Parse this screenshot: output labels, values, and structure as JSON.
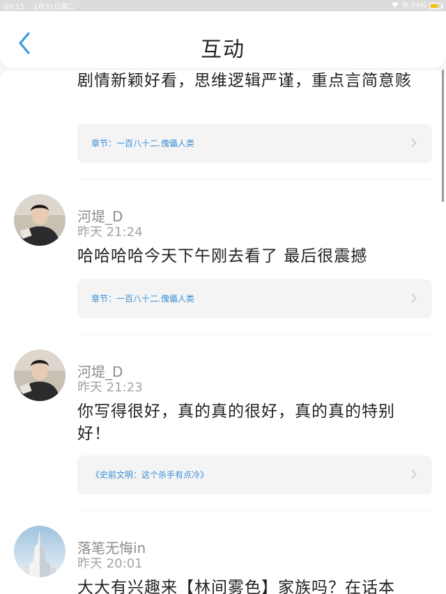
{
  "status": {
    "time": "09:15",
    "date": "1月31日周二",
    "battery": "74%",
    "battery_level": 0.74,
    "battery_color": "#f5c400"
  },
  "nav": {
    "title": "互动",
    "accent": "#3a9be0"
  },
  "comments": [
    {
      "username": "",
      "time": "",
      "text": "剧情新颖好看，思维逻辑严谨，重点言简意赅",
      "ref": "章节：一百八十二.傀儡人类"
    },
    {
      "username": "河堤_D",
      "time": "昨天 21:24",
      "text": "哈哈哈哈今天下午刚去看了 最后很震撼",
      "ref": "章节：一百八十二.傀儡人类"
    },
    {
      "username": "河堤_D",
      "time": "昨天 21:23",
      "text": "你写得很好，真的真的很好，真的真的特别好！",
      "ref": "《史前文明：这个杀手有点冷》"
    },
    {
      "username": "落笔无悔in",
      "time": "昨天 20:01",
      "text": "大大有兴趣来【林间雾色】家族吗？在话本",
      "ref": ""
    }
  ]
}
